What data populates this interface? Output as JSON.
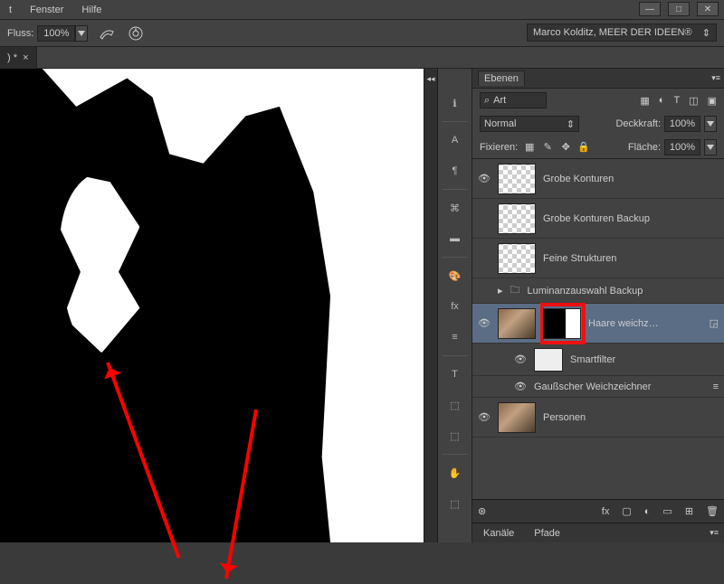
{
  "menu": {
    "items": [
      "t",
      "Fenster",
      "Hilfe"
    ]
  },
  "window_controls": {
    "minimize": "—",
    "maximize": "□",
    "close": "✕"
  },
  "options": {
    "flow_label": "Fluss:",
    "flow_value": "100%",
    "workspace": "Marco Kolditz, MEER DER IDEEN®"
  },
  "doctab": {
    "label": ") *",
    "close": "×"
  },
  "panel": {
    "tab": "Ebenen",
    "search_placeholder": "Art",
    "blend_mode": "Normal",
    "opacity_label": "Deckkraft:",
    "opacity_value": "100%",
    "lock_label": "Fixieren:",
    "fill_label": "Fläche:",
    "fill_value": "100%"
  },
  "layers": [
    {
      "name": "Grobe Konturen",
      "thumb": "checker",
      "visible": true
    },
    {
      "name": "Grobe Konturen Backup",
      "thumb": "checker",
      "visible": false
    },
    {
      "name": "Feine Strukturen",
      "thumb": "checker",
      "visible": false
    },
    {
      "name": "Luminanzauswahl Backup",
      "type": "group",
      "visible": false
    },
    {
      "name": "Haare weichz…",
      "thumb": "photo",
      "mask": true,
      "visible": true,
      "selected": true,
      "highlight_mask": true
    },
    {
      "name": "Smartfilter",
      "thumb": "white",
      "indent": true,
      "visible": true
    },
    {
      "name": "Gaußscher Weichzeichner",
      "type": "filter",
      "indent": true
    },
    {
      "name": "Personen",
      "thumb": "photo",
      "visible": true
    }
  ],
  "layer_footer_icons": [
    "⊛",
    "fx",
    "▢",
    "◐",
    "▭",
    "⊞",
    "🗑"
  ],
  "sub_tabs": [
    "Kanäle",
    "Pfade"
  ],
  "tool_icons": [
    "ℹ",
    "A",
    "¶",
    "⌘",
    "▬",
    "▶",
    "🎨",
    "fx",
    "≡",
    "T",
    "⬚",
    "⬚",
    "✋",
    "⬚"
  ]
}
